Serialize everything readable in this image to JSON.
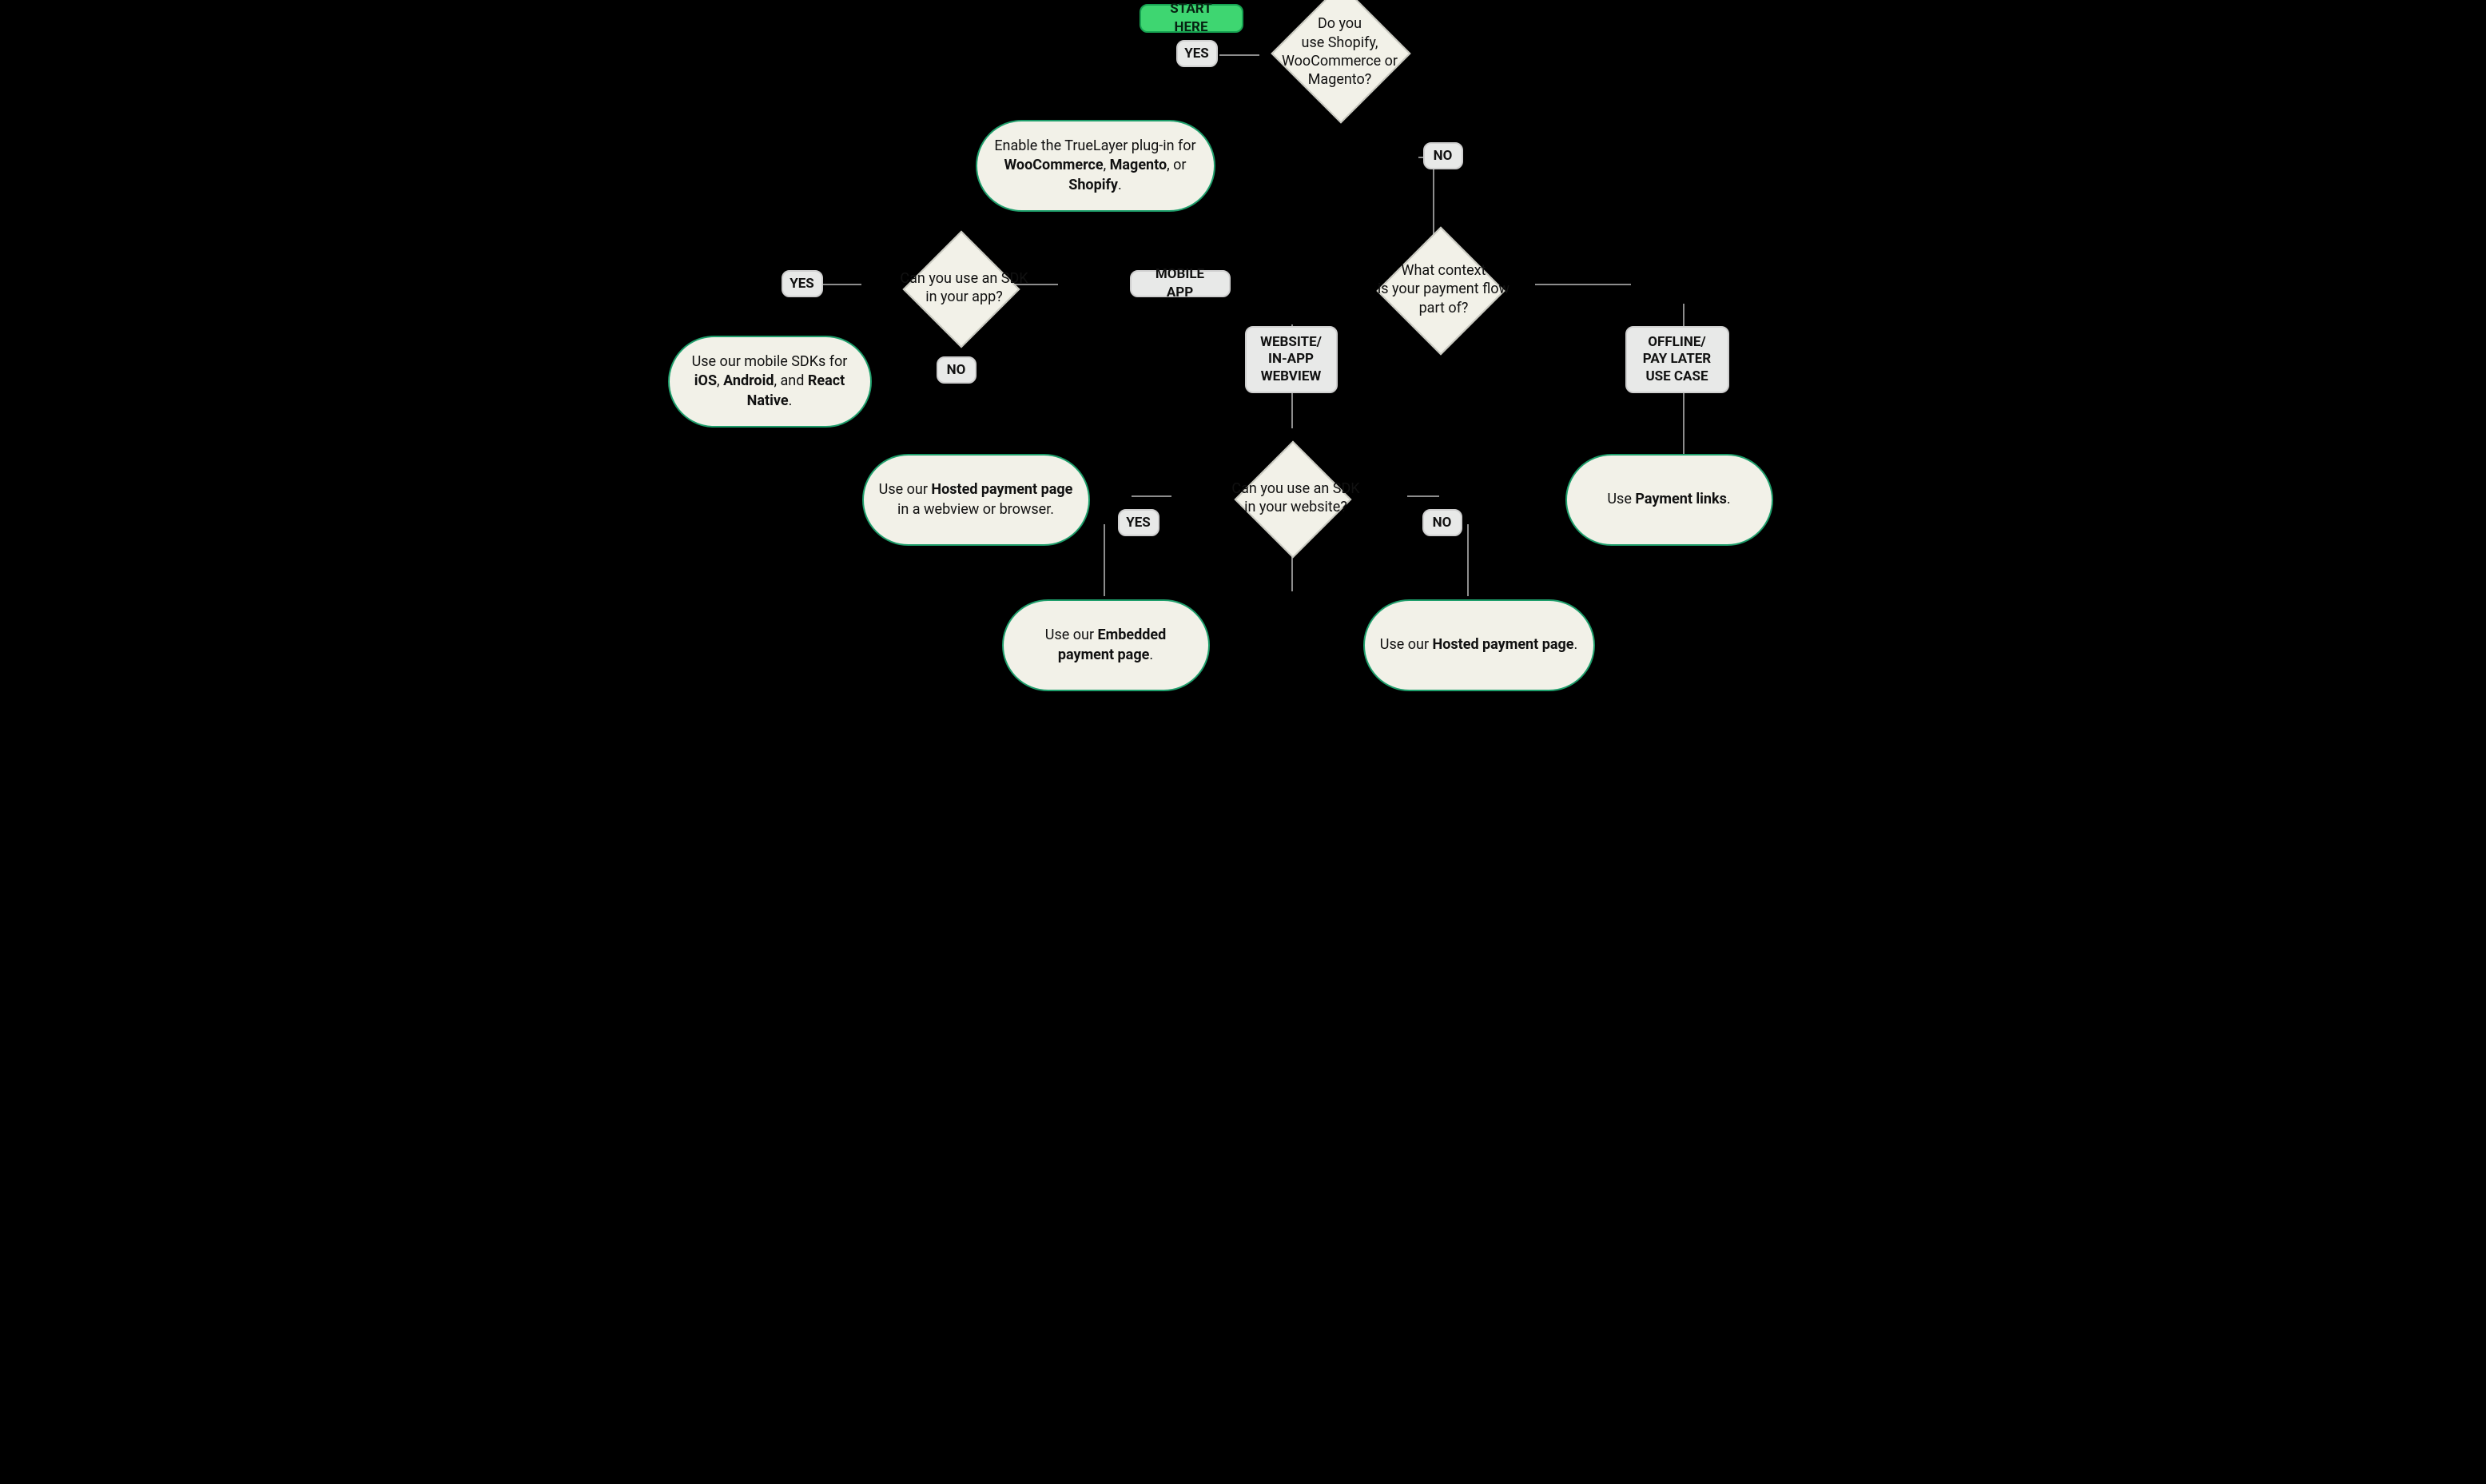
{
  "start_label": "START HERE",
  "decisions": {
    "shopify": "Do you\nuse Shopify,\nWooCommerce or\nMagento?",
    "sdk_app": "Can you use an SDK\nin your app?",
    "context": "What context\nis your payment flow\npart of?",
    "sdk_web": "Can you use an SDK\nin your website?"
  },
  "answers": {
    "yes": "YES",
    "no": "NO",
    "mobile_app": "MOBILE APP",
    "website_webview": "WEBSITE/\nIN-APP\nWEBVIEW",
    "offline": "OFFLINE/\nPAY LATER\nUSE CASE"
  },
  "results": {
    "plugin_pre": "Enable the TrueLayer plug-in for ",
    "plugin_b1": "WooCommerce",
    "plugin_sep1": ", ",
    "plugin_b2": "Magento",
    "plugin_sep2": ", or ",
    "plugin_b3": "Shopify",
    "plugin_post": ".",
    "mobile_sdk_pre": "Use our mobile SDKs for ",
    "mobile_b1": "iOS",
    "mobile_sep1": ", ",
    "mobile_b2": "Android",
    "mobile_sep2": ", and ",
    "mobile_b3": "React Native",
    "mobile_post": ".",
    "hpp_webview_pre": "Use our ",
    "hpp_webview_b": "Hosted payment page",
    "hpp_webview_post": " in a webview or browser.",
    "payment_links_pre": "Use ",
    "payment_links_b": "Payment links",
    "payment_links_post": ".",
    "embedded_pre": "Use our ",
    "embedded_b": "Embedded payment page",
    "embedded_post": ".",
    "hpp_pre": "Use our ",
    "hpp_b": "Hosted payment page",
    "hpp_post": "."
  }
}
